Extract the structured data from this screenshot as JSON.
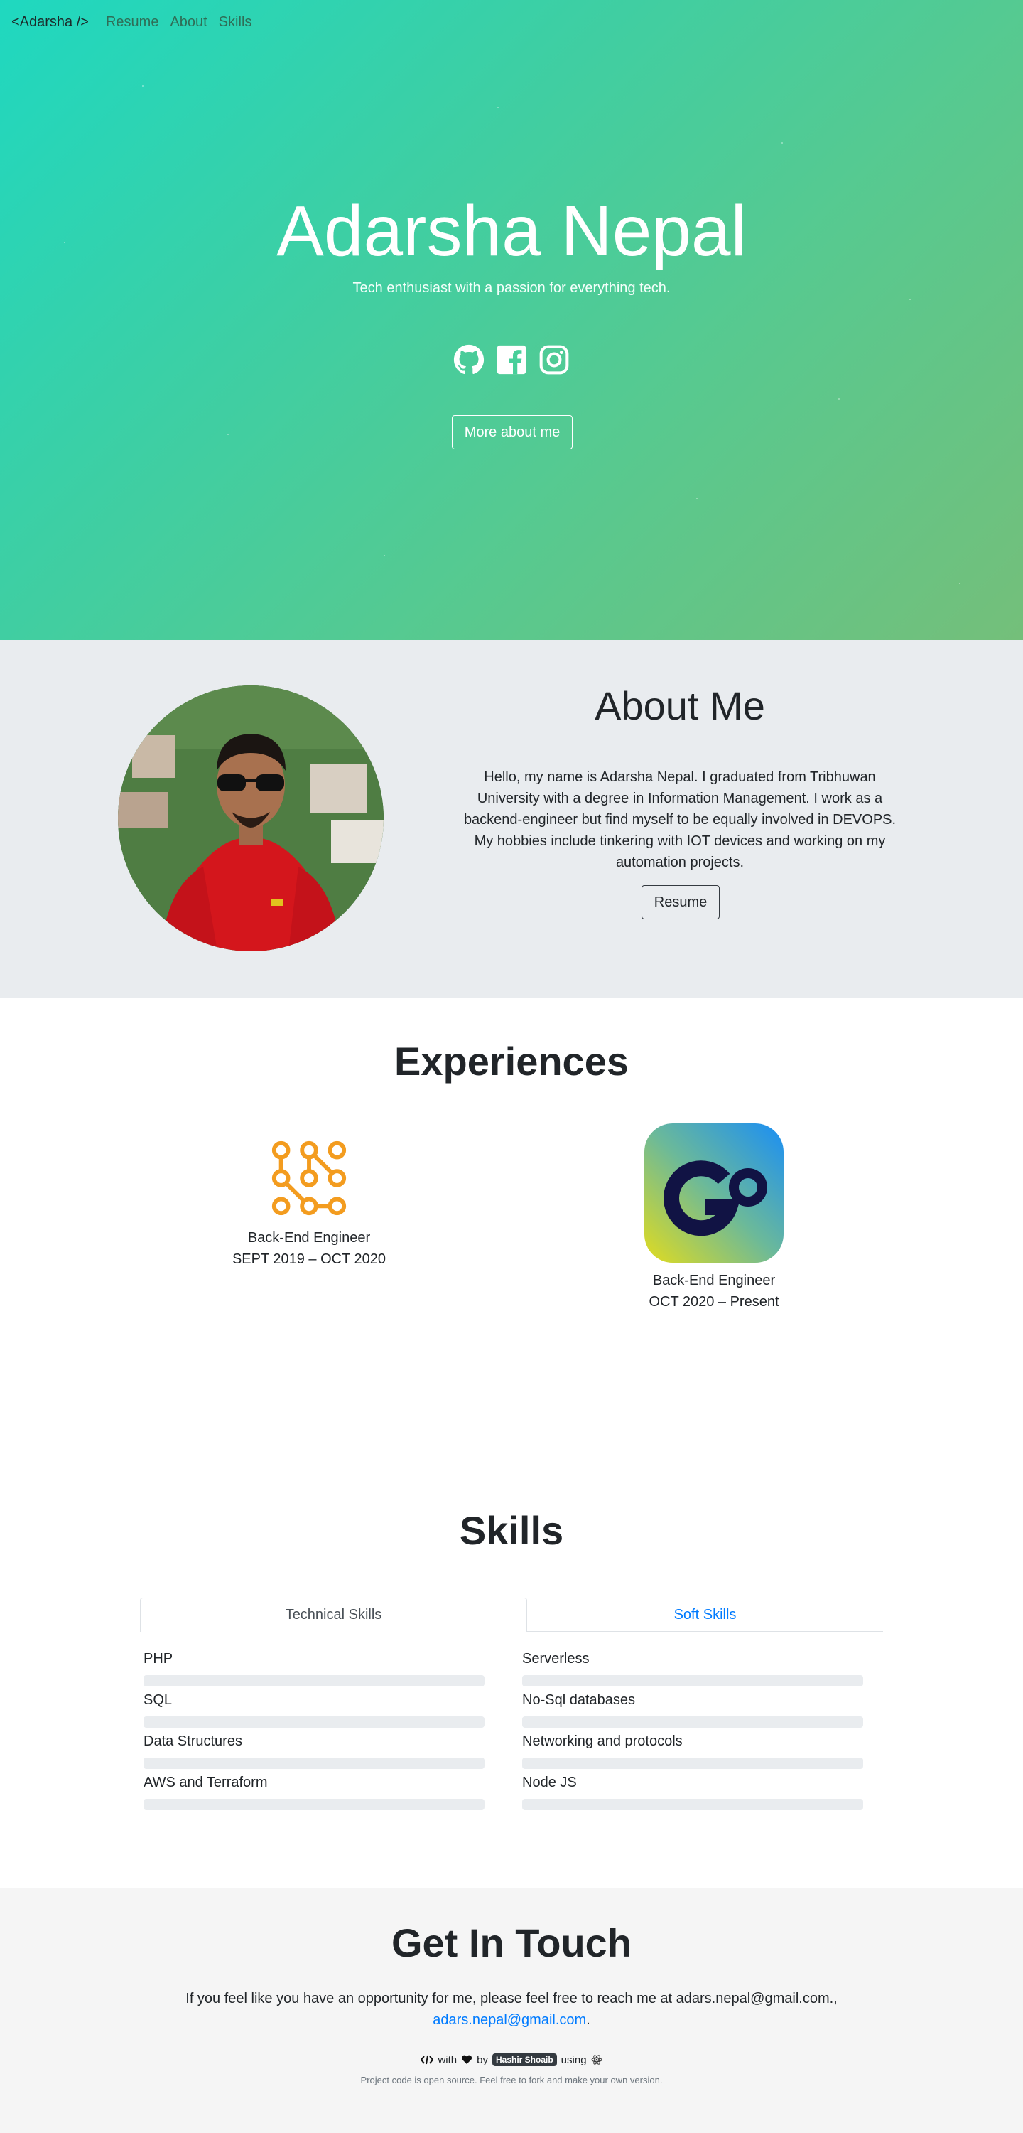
{
  "nav": {
    "brand": "<Adarsha />",
    "links": [
      "Resume",
      "About",
      "Skills"
    ]
  },
  "hero": {
    "title": "Adarsha Nepal",
    "subtitle": "Tech enthusiast with a passion for everything tech.",
    "socials": [
      "github-icon",
      "facebook-icon",
      "instagram-icon"
    ],
    "button_label": "More about me"
  },
  "about": {
    "title": "About Me",
    "text": "Hello, my name is Adarsha Nepal. I graduated from Tribhuwan University with a degree in Information Management. I work as a backend-engineer but find myself to be equally involved in DEVOPS. My hobbies include tinkering with IOT devices and working on my automation projects.",
    "button_label": "Resume"
  },
  "experiences": {
    "title": "Experiences",
    "items": [
      {
        "role": "Back-End Engineer",
        "period": "SEPT 2019 – OCT 2020"
      },
      {
        "role": "Back-End Engineer",
        "period": "OCT 2020 – Present"
      }
    ]
  },
  "skills": {
    "title": "Skills",
    "tabs": [
      "Technical Skills",
      "Soft Skills"
    ],
    "left": [
      {
        "name": "PHP"
      },
      {
        "name": "SQL"
      },
      {
        "name": "Data Structures"
      },
      {
        "name": "AWS and Terraform"
      }
    ],
    "right": [
      {
        "name": "Serverless"
      },
      {
        "name": "No-Sql databases"
      },
      {
        "name": "Networking and protocols"
      },
      {
        "name": "Node JS"
      }
    ]
  },
  "contact": {
    "title": "Get In Touch",
    "text": "If you feel like you have an opportunity for me, please feel free to reach me at adars.nepal@gmail.com.,",
    "email": "adars.nepal@gmail.com",
    "period": "."
  },
  "footer": {
    "with": "with",
    "by": "by",
    "author": "Hashir Shoaib",
    "using": "using",
    "note": "Project code is open source. Feel free to fork and make your own version."
  },
  "colors": {
    "hero_start": "#1fd8c0",
    "hero_end": "#74bf7a",
    "link_blue": "#007bff",
    "experience_icon": "#f39c1f"
  }
}
